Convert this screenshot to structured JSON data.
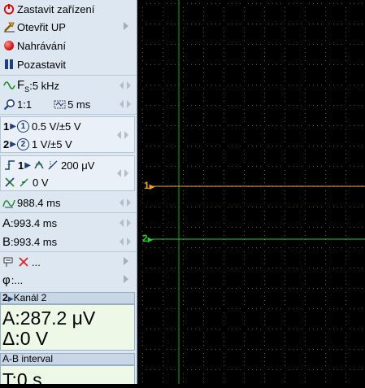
{
  "menu": {
    "stop_device": "Zastavit zařízení",
    "open_up": "Otevřit UP",
    "recording": "Nahrávání",
    "pause": "Pozastavit"
  },
  "sampling": {
    "fs": "5 kHz",
    "zoom": "1:1",
    "timebase": "5 ms"
  },
  "channels": [
    {
      "number": "1",
      "circle": "1",
      "range": "0.5 V/±5 V"
    },
    {
      "number": "2",
      "circle": "2",
      "range": "1 V/±5 V"
    }
  ],
  "trigger": {
    "channel": "1",
    "level": "200 μV",
    "offset": "0 V"
  },
  "cursors": {
    "delta_t": "988.4 ms",
    "a_label": "A",
    "a": "993.4 ms",
    "b_label": "B",
    "b": "993.4 ms"
  },
  "extra": {
    "row1": "...",
    "row2": "..."
  },
  "channel_info": {
    "header_num": "2",
    "header": "Kanál 2",
    "a_value": "A:287.2 μV",
    "delta_value": "Δ:0 V"
  },
  "ab_interval": {
    "header": "A-B interval",
    "t_value": "T:0 s"
  },
  "scope": {
    "ch1_label": "1",
    "ch2_label": "2",
    "ch1_color": "#f0a52a",
    "ch2_color": "#26d026"
  }
}
